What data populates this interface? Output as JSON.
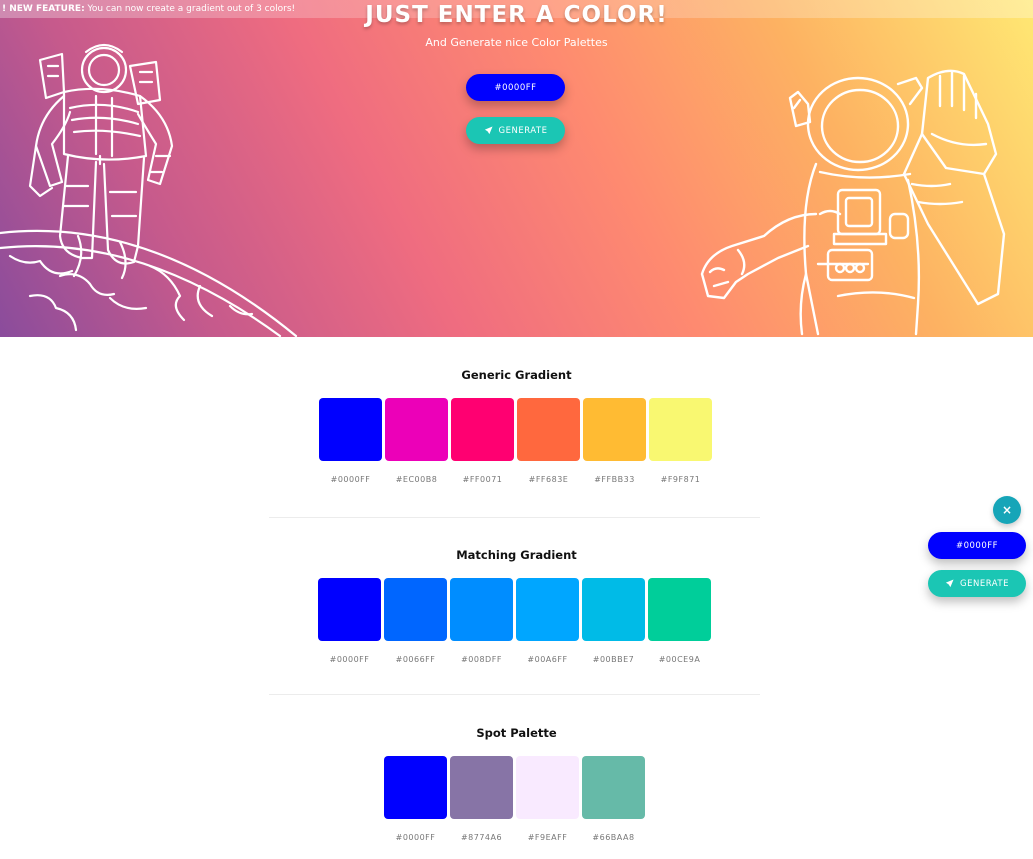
{
  "notice": {
    "label": "! NEW FEATURE:",
    "text": " You can now create a gradient out of 3 colors!"
  },
  "hero": {
    "title": "JUST ENTER A COLOR!",
    "subtitle": "And Generate nice Color Palettes",
    "color_value": "#0000FF",
    "generate_label": "GENERATE"
  },
  "palettes": [
    {
      "title": "Generic Gradient",
      "colors": [
        "#0000FF",
        "#EC00B8",
        "#FF0071",
        "#FF683E",
        "#FFBB33",
        "#F9F871"
      ]
    },
    {
      "title": "Matching Gradient",
      "colors": [
        "#0000FF",
        "#0066FF",
        "#008DFF",
        "#00A6FF",
        "#00BBE7",
        "#00CE9A"
      ]
    },
    {
      "title": "Spot Palette",
      "colors": [
        "#0000FF",
        "#8774A6",
        "#F9EAFF",
        "#66BAA8"
      ]
    }
  ],
  "floating": {
    "close_icon": "×",
    "color_value": "#0000FF",
    "generate_label": "GENERATE"
  },
  "icons": {
    "close": "close-icon",
    "rocket": "rocket-icon"
  },
  "colors": {
    "accent_blue": "#0000FF",
    "accent_teal": "#1BC6B4",
    "close_bg": "#16A5B8"
  }
}
